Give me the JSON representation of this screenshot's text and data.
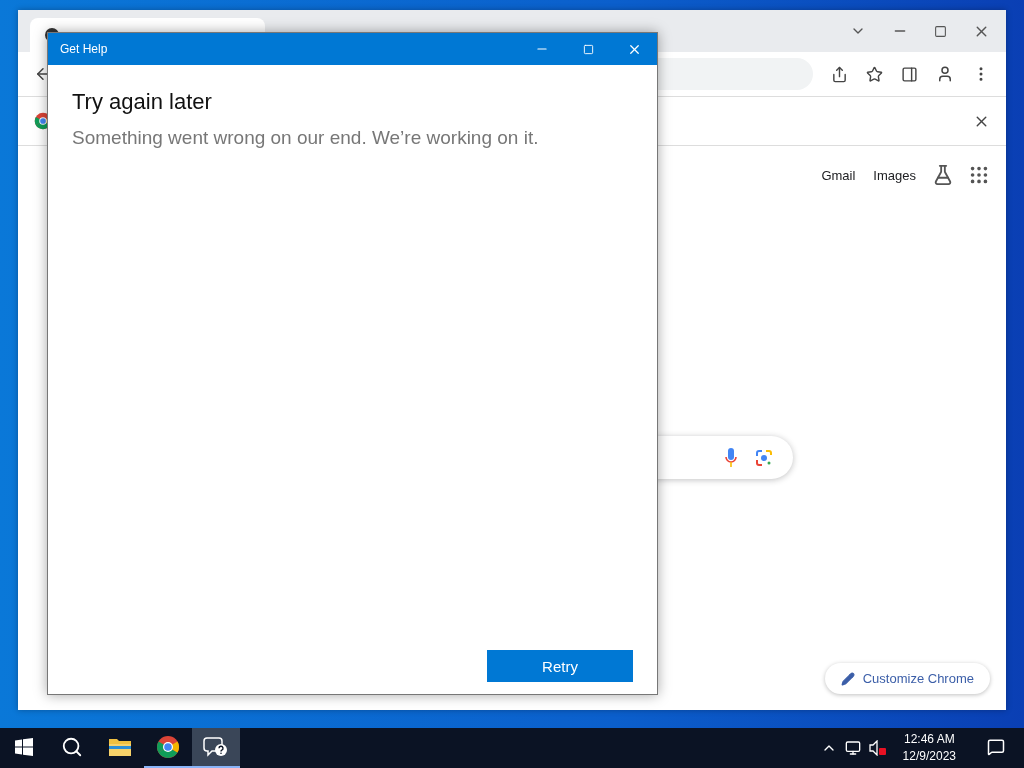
{
  "browser": {
    "nav_links": [
      "Gmail",
      "Images"
    ],
    "customize_button": "Customize Chrome"
  },
  "dialog": {
    "title": "Get Help",
    "heading": "Try again later",
    "message": "Something went wrong on our end. We’re working on it.",
    "button": "Retry"
  },
  "taskbar": {
    "apps": [
      {
        "kind": "explorer",
        "running": false,
        "selected": false
      },
      {
        "kind": "chrome",
        "running": true,
        "selected": false
      },
      {
        "kind": "help",
        "running": true,
        "selected": true
      }
    ],
    "time": "12:46 AM",
    "date": "12/9/2023"
  }
}
